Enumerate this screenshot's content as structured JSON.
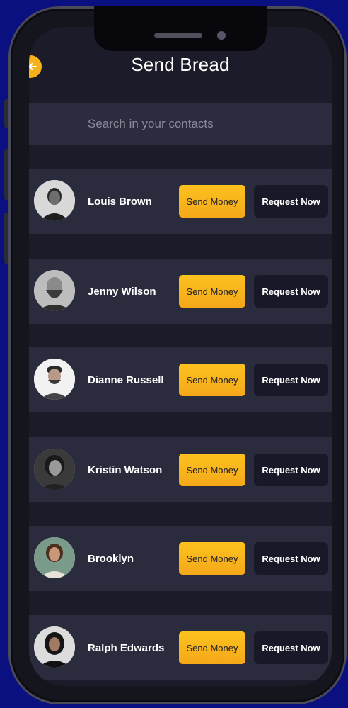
{
  "header": {
    "title": "Send Bread"
  },
  "search": {
    "placeholder": "Search in your contacts"
  },
  "colors": {
    "accent": "#f6b21a",
    "row": "#2b2b3e",
    "background": "#1b1b29",
    "frame": "#0b1080"
  },
  "contacts": [
    {
      "name": "Louis Brown",
      "send_label": "Send Money",
      "request_label": "Request Now"
    },
    {
      "name": "Jenny Wilson",
      "send_label": "Send Money",
      "request_label": "Request Now"
    },
    {
      "name": "Dianne Russell",
      "send_label": "Send Money",
      "request_label": "Request Now"
    },
    {
      "name": "Kristin Watson",
      "send_label": "Send Money",
      "request_label": "Request Now"
    },
    {
      "name": "Brooklyn",
      "send_label": "Send Money",
      "request_label": "Request Now"
    },
    {
      "name": "Ralph Edwards",
      "send_label": "Send Money",
      "request_label": "Request Now"
    }
  ]
}
